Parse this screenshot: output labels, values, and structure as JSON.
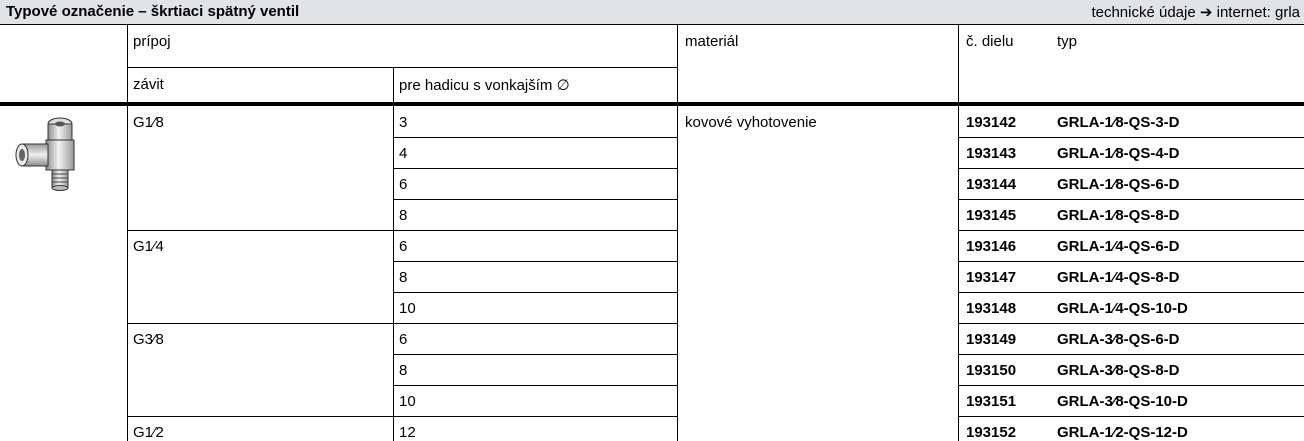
{
  "header": {
    "title": "Typové označenie – škrtiaci spätný ventil",
    "note_prefix": "technické údaje",
    "note_arrow": "➔",
    "note_suffix": "internet: grla"
  },
  "columns": {
    "pripoj": "prípoj",
    "zavit": "závit",
    "hadica": "pre hadicu s vonkajším ∅",
    "material": "materiál",
    "diel": "č. dielu",
    "typ": "typ"
  },
  "material_value": "kovové vyhotovenie",
  "threads": [
    "G1⁄8",
    "G1⁄4",
    "G3⁄8",
    "G1⁄2"
  ],
  "rows": [
    {
      "hose": "3",
      "part": "193142",
      "type": "GRLA-1⁄8-QS-3-D"
    },
    {
      "hose": "4",
      "part": "193143",
      "type": "GRLA-1⁄8-QS-4-D"
    },
    {
      "hose": "6",
      "part": "193144",
      "type": "GRLA-1⁄8-QS-6-D"
    },
    {
      "hose": "8",
      "part": "193145",
      "type": "GRLA-1⁄8-QS-8-D"
    },
    {
      "hose": "6",
      "part": "193146",
      "type": "GRLA-1⁄4-QS-6-D"
    },
    {
      "hose": "8",
      "part": "193147",
      "type": "GRLA-1⁄4-QS-8-D"
    },
    {
      "hose": "10",
      "part": "193148",
      "type": "GRLA-1⁄4-QS-10-D"
    },
    {
      "hose": "6",
      "part": "193149",
      "type": "GRLA-3⁄8-QS-6-D"
    },
    {
      "hose": "8",
      "part": "193150",
      "type": "GRLA-3⁄8-QS-8-D"
    },
    {
      "hose": "10",
      "part": "193151",
      "type": "GRLA-3⁄8-QS-10-D"
    },
    {
      "hose": "12",
      "part": "193152",
      "type": "GRLA-1⁄2-QS-12-D"
    }
  ],
  "colors": {
    "title_bg": "#e1e3e6",
    "rule": "#000000"
  },
  "icons": {
    "product": "throttle-check-valve-illustration"
  }
}
